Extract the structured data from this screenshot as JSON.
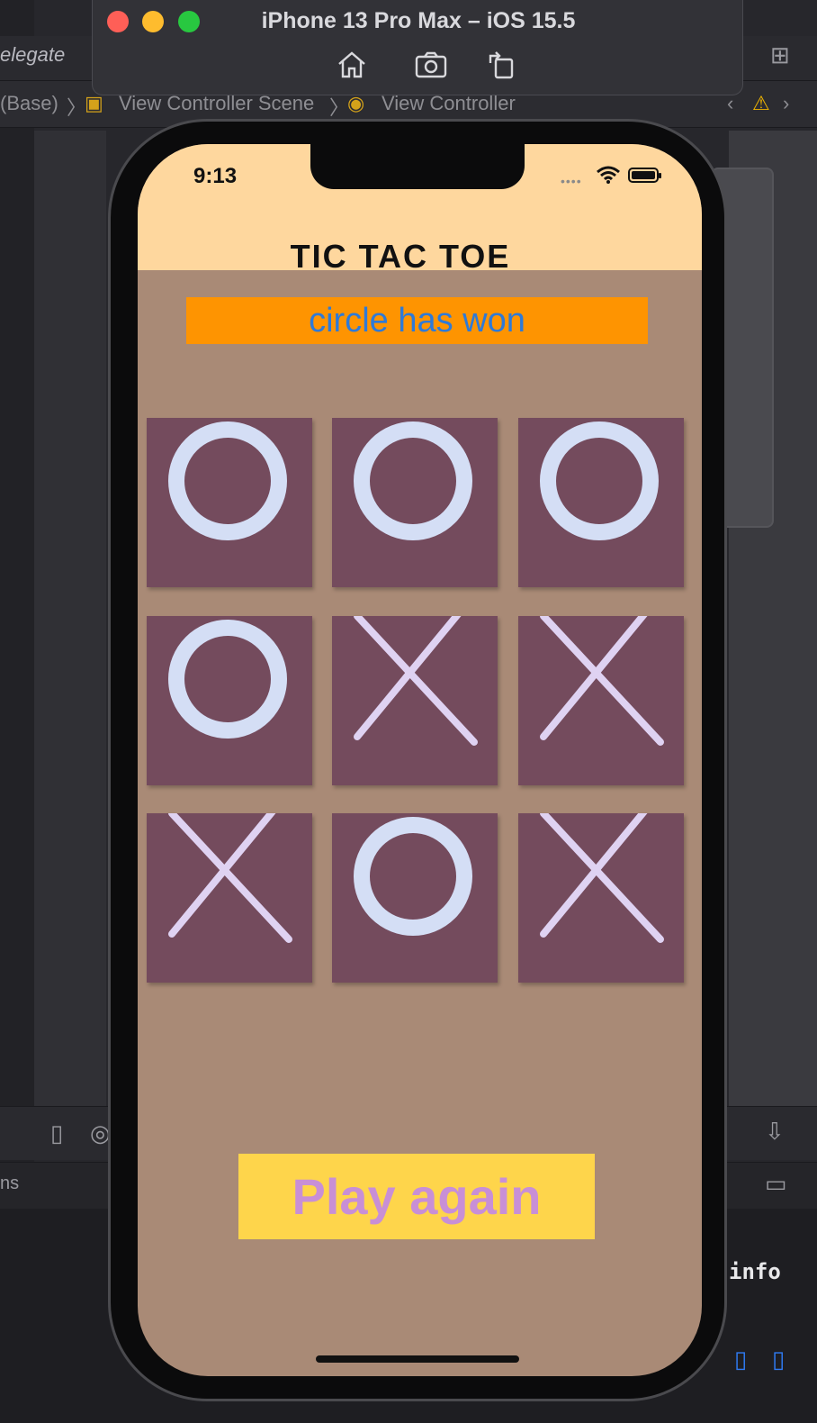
{
  "xcode": {
    "file_label": "elegate",
    "breadcrumb": [
      "(Base)",
      "View Controller Scene",
      "View Controller"
    ],
    "console_text": "info",
    "left_text": "ns"
  },
  "simulator": {
    "title": "iPhone 13 Pro Max – iOS 15.5",
    "toolbar": [
      "home-icon",
      "screenshot-icon",
      "rotate-icon"
    ]
  },
  "phone": {
    "status_time": "9:13"
  },
  "app": {
    "title": "TIC TAC TOE",
    "status_message": "circle has won",
    "board": [
      "O",
      "O",
      "O",
      "O",
      "X",
      "X",
      "X",
      "O",
      "X"
    ],
    "play_again_label": "Play again",
    "colors": {
      "header": "#fed79e",
      "background": "#a98a76",
      "banner": "#fe9401",
      "banner_text": "#2e7ad8",
      "cell": "#744b5d",
      "mark_o": "#d4def5",
      "mark_x": "#dfd2f2",
      "button": "#fed54b",
      "button_text": "#c88fd6"
    }
  }
}
